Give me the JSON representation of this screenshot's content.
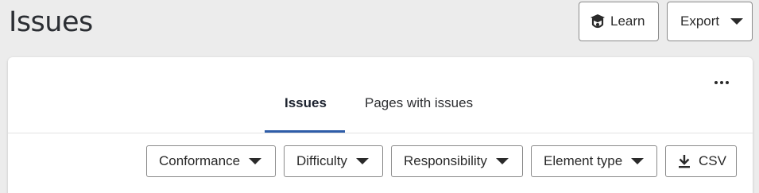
{
  "header": {
    "title": "Issues",
    "learn_label": "Learn",
    "export_label": "Export"
  },
  "tabs": [
    {
      "label": "Issues",
      "active": true
    },
    {
      "label": "Pages with issues",
      "active": false
    }
  ],
  "filters": {
    "conformance": "Conformance",
    "difficulty": "Difficulty",
    "responsibility": "Responsibility",
    "element_type": "Element type",
    "csv": "CSV"
  },
  "icons": {
    "learn": "graduation-cap-icon",
    "more": "more-options-icon",
    "download": "download-icon"
  },
  "colors": {
    "active_tab_underline": "#2e5da8",
    "background": "#ececec"
  }
}
